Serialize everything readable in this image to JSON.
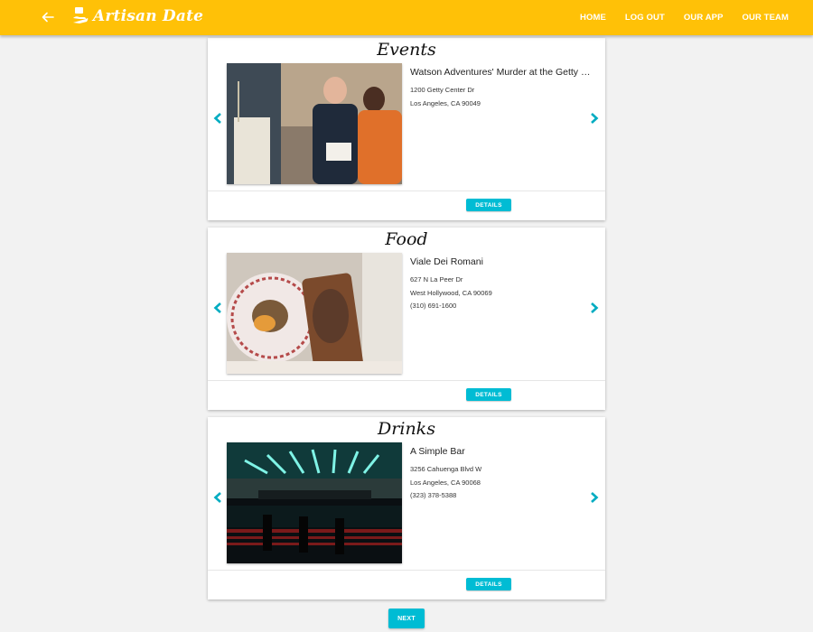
{
  "header": {
    "logo_text": "Artisan Date",
    "nav": [
      "HOME",
      "LOG OUT",
      "OUR APP",
      "OUR TEAM"
    ]
  },
  "cards": [
    {
      "title": "Events",
      "name": "Watson Adventures' Murder at the Getty S...",
      "lines": [
        "1200 Getty Center Dr",
        "Los Angeles, CA 90049"
      ],
      "button": "DETAILS"
    },
    {
      "title": "Food",
      "name": "Viale Dei Romani",
      "lines": [
        "627 N La Peer Dr",
        "West Hollywood, CA 90069",
        "(310) 691-1600"
      ],
      "button": "DETAILS"
    },
    {
      "title": "Drinks",
      "name": "A Simple Bar",
      "lines": [
        "3256 Cahuenga Blvd W",
        "Los Angeles, CA 90068",
        "(323) 378-5388"
      ],
      "button": "DETAILS"
    }
  ],
  "next_button": "NEXT",
  "colors": {
    "appbar": "#ffc107",
    "accent": "#00bcd4"
  },
  "icons": [
    "back-arrow-icon",
    "logo-icon",
    "chevron-left-icon",
    "chevron-right-icon"
  ]
}
